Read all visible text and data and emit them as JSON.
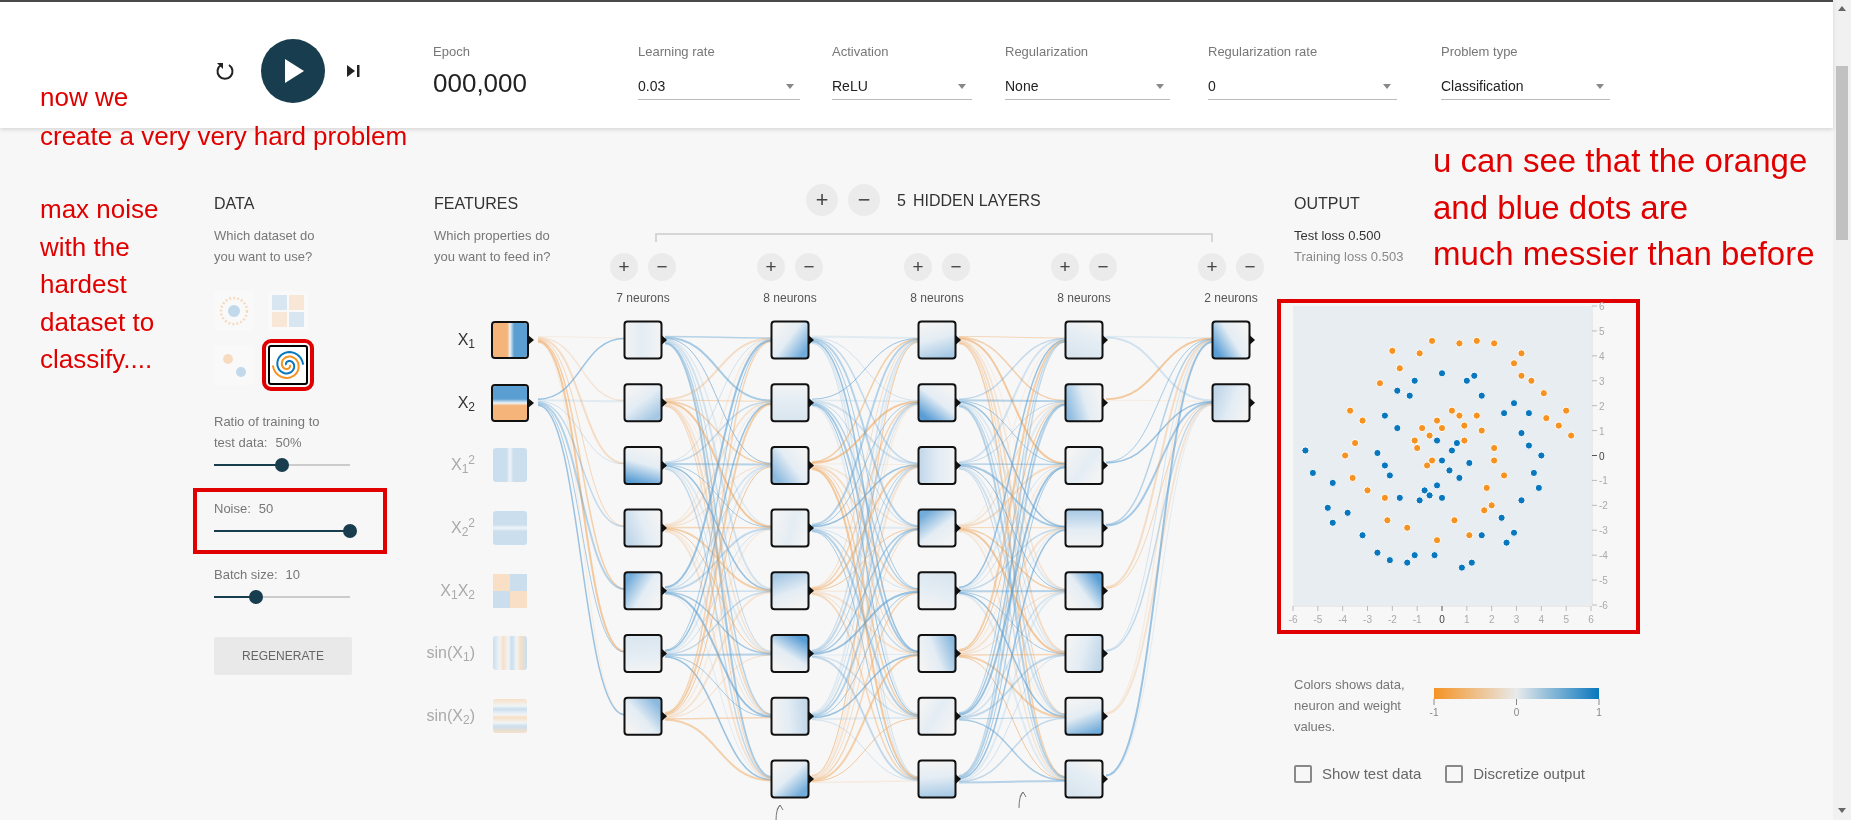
{
  "top_bar": {
    "epoch": {
      "label": "Epoch",
      "value": "000,000"
    },
    "dropdowns": [
      {
        "label": "Learning rate",
        "value": "0.03"
      },
      {
        "label": "Activation",
        "value": "ReLU"
      },
      {
        "label": "Regularization",
        "value": "None"
      },
      {
        "label": "Regularization rate",
        "value": "0"
      },
      {
        "label": "Problem type",
        "value": "Classification"
      }
    ]
  },
  "data": {
    "title": "DATA",
    "question": "Which dataset do you want to use?",
    "datasets": [
      {
        "kind": "circle",
        "selected": false,
        "highlighted": false
      },
      {
        "kind": "xor",
        "selected": false,
        "highlighted": false
      },
      {
        "kind": "gaussian",
        "selected": false,
        "highlighted": false
      },
      {
        "kind": "spiral",
        "selected": true,
        "highlighted": true
      }
    ],
    "sliders": [
      {
        "label": "Ratio of training to test data:",
        "value": "50%",
        "level": 0.5,
        "highlighted": false
      },
      {
        "label": "Noise:",
        "value": "50",
        "level": 1,
        "highlighted": true
      },
      {
        "label": "Batch size:",
        "value": "10",
        "level": 0.31,
        "highlighted": false
      }
    ],
    "regenerate": "REGENERATE"
  },
  "features": {
    "title": "FEATURES",
    "question": "Which properties do you want to feed in?",
    "items": [
      {
        "kind": "x1",
        "label": "X$_{1}$",
        "active": true
      },
      {
        "kind": "x2",
        "label": "X$_{2}$",
        "active": true
      },
      {
        "kind": "x1sq",
        "label": "X$_{1}$$^{2}$",
        "active": false
      },
      {
        "kind": "x2sq",
        "label": "X$_{2}$$^{2}$",
        "active": false
      },
      {
        "kind": "x1x2",
        "label": "X$_{1}$X$_{2}$",
        "active": false
      },
      {
        "kind": "sinx1",
        "label": "sin(X$_{1}$)",
        "active": false
      },
      {
        "kind": "sinx2",
        "label": "sin(X$_{2}$)",
        "active": false
      }
    ]
  },
  "network": {
    "add": "+",
    "remove": "−",
    "count": "5",
    "title": "HIDDEN LAYERS",
    "layers": [
      {
        "add": "+",
        "remove": "−",
        "label": "7 neurons"
      },
      {
        "add": "+",
        "remove": "−",
        "label": "8 neurons"
      },
      {
        "add": "+",
        "remove": "−",
        "label": "8 neurons"
      },
      {
        "add": "+",
        "remove": "−",
        "label": "8 neurons"
      },
      {
        "add": "+",
        "remove": "−",
        "label": "2 neurons"
      }
    ]
  },
  "output": {
    "title": "OUTPUT",
    "test_loss": "Test loss 0.500",
    "training_loss": "Training loss 0.503",
    "highlighted": true,
    "chart_data": {
      "type": "scatter",
      "xlim": [
        -6,
        6
      ],
      "ylim": [
        -6,
        6
      ],
      "xticks": [
        -6,
        -5,
        -4,
        -3,
        -2,
        -1,
        0,
        1,
        2,
        3,
        4,
        5,
        6
      ],
      "yticks": [
        -6,
        -5,
        -4,
        -3,
        -2,
        -1,
        0,
        1,
        2,
        3,
        4,
        5,
        6
      ],
      "series": [
        {
          "color": "#f59322",
          "x": [
            -0.4,
            0.7,
            1.4,
            2.1,
            3.2,
            2.9,
            3.2,
            3.6,
            4.1,
            4.2,
            5.0,
            4.7,
            5.2,
            -2.0,
            -0.9,
            -1.7,
            -2.5,
            -3.7,
            -3.2,
            -3.5,
            -3.9,
            -3.6,
            -3.0,
            -2.3,
            -2.2,
            -1.4,
            -0.2,
            0.5,
            1.1,
            1.7,
            2.0,
            1.8,
            2.5,
            2.1,
            2.1,
            1.6,
            1.4,
            0.4,
            -0.8,
            -1.0,
            -0.6,
            0.0,
            0.9,
            -0.5,
            -0.2,
            0.7,
            -1.1,
            -0.4,
            0.9
          ],
          "values": [
            4.6,
            4.5,
            4.6,
            4.5,
            4.1,
            3.7,
            3.2,
            3.0,
            2.5,
            1.5,
            1.8,
            1.2,
            0.8,
            4.2,
            4.1,
            3.5,
            2.9,
            1.8,
            1.4,
            0.5,
            0.0,
            -0.9,
            -1.4,
            -1.7,
            -2.6,
            -2.9,
            -3.4,
            -2.6,
            -3.2,
            -2.2,
            -2.0,
            -1.3,
            -0.8,
            -0.2,
            0.3,
            1.0,
            1.6,
            1.8,
            1.1,
            0.3,
            -0.4,
            1.1,
            0.6,
            0.8,
            1.4,
            1.6,
            0.6,
            -0.2,
            1.2
          ]
        },
        {
          "color": "#0877bd",
          "x": [
            -5.5,
            -5.2,
            -4.4,
            -4.6,
            -4.4,
            -3.8,
            -3.2,
            -2.6,
            -2.1,
            -1.4,
            -1.1,
            -0.3,
            0.8,
            1.2,
            1.6,
            2.4,
            2.9,
            2.6,
            3.2,
            3.9,
            3.7,
            4.0,
            3.5,
            3.2,
            3.5,
            2.9,
            2.5,
            1.6,
            1.3,
            0.0,
            -1.1,
            -1.3,
            -1.8,
            -2.3,
            -1.8,
            -2.6,
            -2.3,
            -2.1,
            -1.7,
            -0.7,
            -0.2,
            0.0,
            0.7,
            1.1,
            0.4,
            -0.2,
            0.6,
            0.0,
            0.3,
            -0.5,
            1.0,
            -0.9
          ],
          "values": [
            0.2,
            -0.7,
            -1.1,
            -2.1,
            -2.7,
            -2.3,
            -3.2,
            -3.9,
            -4.2,
            -4.3,
            -4.0,
            -4.0,
            -4.5,
            -4.3,
            -3.2,
            -2.5,
            -3.1,
            -3.5,
            -1.8,
            -1.3,
            -0.7,
            0.0,
            0.4,
            0.9,
            1.7,
            2.1,
            1.7,
            2.4,
            3.2,
            3.3,
            3.0,
            2.4,
            2.6,
            1.6,
            1.1,
            0.1,
            -0.4,
            -0.8,
            -1.7,
            -1.4,
            -1.2,
            -1.7,
            -0.9,
            -0.3,
            0.2,
            0.6,
            0.5,
            -0.2,
            -0.6,
            -1.6,
            3.0,
            -1.8
          ]
        }
      ]
    },
    "legend": {
      "text": "Colors shows data, neuron and weight values.",
      "ticks": [
        "-1",
        "0",
        "1"
      ]
    },
    "checkboxes": [
      {
        "label": "Show test data",
        "checked": false
      },
      {
        "label": "Discretize output",
        "checked": false
      }
    ]
  },
  "annotations": [
    {
      "lines": [
        "now we"
      ]
    },
    {
      "lines": [
        "create a very very hard problem"
      ]
    },
    {
      "lines": [
        "max noise",
        "with the",
        "hardest",
        "dataset to",
        "classify...."
      ]
    },
    {
      "lines": [
        "u can see that the orange",
        "and blue dots are",
        "much messier than before"
      ]
    }
  ]
}
